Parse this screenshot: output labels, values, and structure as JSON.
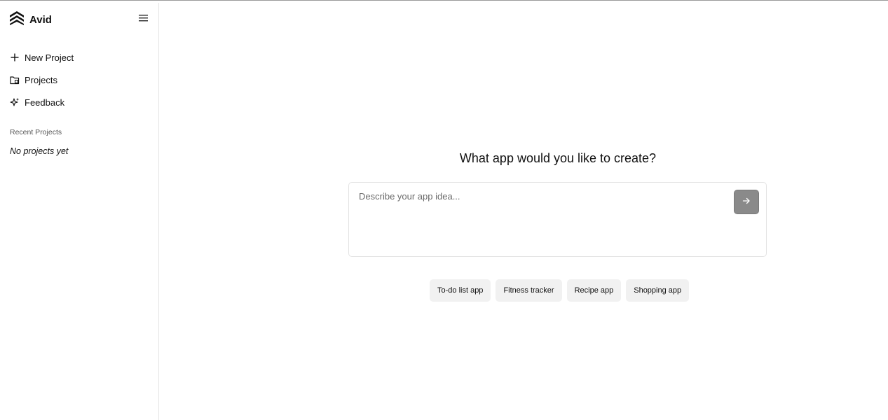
{
  "brand": {
    "name": "Avid",
    "logo_icon": "avid-chevrons-logo"
  },
  "sidebar": {
    "menu_icon": "hamburger-menu-icon",
    "items": [
      {
        "label": "New Project",
        "icon": "plus-icon"
      },
      {
        "label": "Projects",
        "icon": "folder-icon"
      },
      {
        "label": "Feedback",
        "icon": "sparkle-icon"
      }
    ],
    "recent_heading": "Recent Projects",
    "recent_empty": "No projects yet"
  },
  "main": {
    "heading": "What app would you like to create?",
    "prompt": {
      "placeholder": "Describe your app idea...",
      "value": ""
    },
    "send_icon": "arrow-right-icon",
    "suggestions": [
      "To-do list app",
      "Fitness tracker",
      "Recipe app",
      "Shopping app"
    ]
  },
  "colors": {
    "send_button": "#8a8a8a",
    "chip_bg": "#f1f1f1",
    "border": "#e3e3e3"
  }
}
